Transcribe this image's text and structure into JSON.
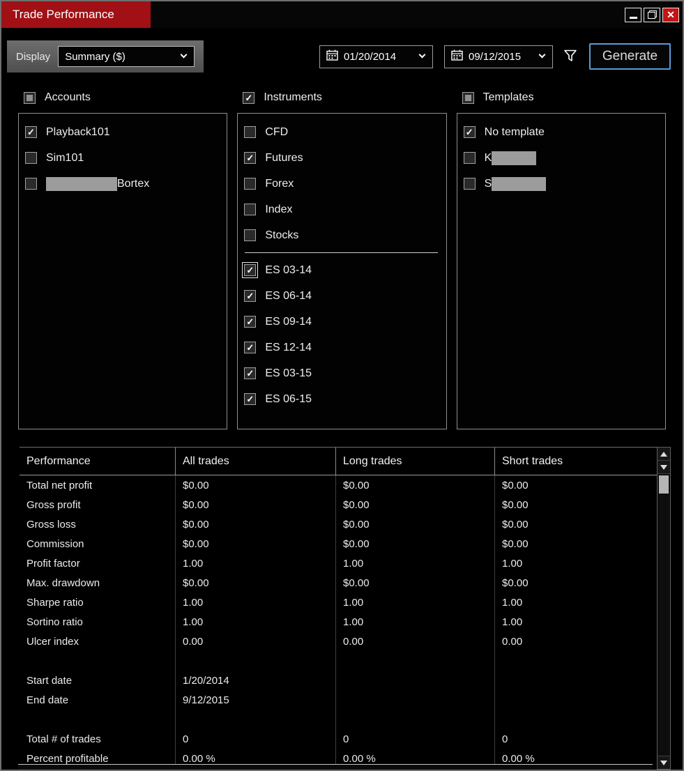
{
  "window": {
    "title": "Trade Performance"
  },
  "colors": {
    "title_red": "#a01015",
    "close_red": "#c41414",
    "generate_blue": "#5b9bd5",
    "redact_gray": "#9c9c9c"
  },
  "icons": {
    "check": "✓",
    "close": "✕"
  },
  "toolbar": {
    "display_label": "Display",
    "display_value": "Summary ($)",
    "date_from": "01/20/2014",
    "date_to": "09/12/2015",
    "generate_label": "Generate"
  },
  "sections": {
    "accounts": {
      "label": "Accounts",
      "state": "indeterminate",
      "items": [
        {
          "label": "Playback101",
          "checked": true
        },
        {
          "label": "Sim101",
          "checked": false
        },
        {
          "label": "Bortex",
          "checked": false,
          "redact": "prefix",
          "redact_width": 102
        }
      ]
    },
    "instruments": {
      "label": "Instruments",
      "state": "checked",
      "items": [
        {
          "label": "CFD",
          "checked": false
        },
        {
          "label": "Futures",
          "checked": true
        },
        {
          "label": "Forex",
          "checked": false
        },
        {
          "label": "Index",
          "checked": false
        },
        {
          "label": "Stocks",
          "checked": false,
          "divider_after": true
        },
        {
          "label": "ES 03-14",
          "checked": true,
          "focused": true
        },
        {
          "label": "ES 06-14",
          "checked": true
        },
        {
          "label": "ES 09-14",
          "checked": true
        },
        {
          "label": "ES 12-14",
          "checked": true
        },
        {
          "label": "ES 03-15",
          "checked": true
        },
        {
          "label": "ES 06-15",
          "checked": true
        }
      ]
    },
    "templates": {
      "label": "Templates",
      "state": "indeterminate",
      "items": [
        {
          "label": "No template",
          "checked": true
        },
        {
          "label": "K",
          "checked": false,
          "redact": "suffix",
          "redact_width": 64
        },
        {
          "label": "S",
          "checked": false,
          "redact": "suffix",
          "redact_width": 78
        }
      ]
    }
  },
  "table": {
    "headers": [
      "Performance",
      "All trades",
      "Long trades",
      "Short trades"
    ],
    "rows": [
      {
        "label": "Total net profit",
        "all": "$0.00",
        "long": "$0.00",
        "short": "$0.00"
      },
      {
        "label": "Gross profit",
        "all": "$0.00",
        "long": "$0.00",
        "short": "$0.00"
      },
      {
        "label": "Gross loss",
        "all": "$0.00",
        "long": "$0.00",
        "short": "$0.00"
      },
      {
        "label": "Commission",
        "all": "$0.00",
        "long": "$0.00",
        "short": "$0.00"
      },
      {
        "label": "Profit factor",
        "all": "1.00",
        "long": "1.00",
        "short": "1.00"
      },
      {
        "label": "Max. drawdown",
        "all": "$0.00",
        "long": "$0.00",
        "short": "$0.00"
      },
      {
        "label": "Sharpe ratio",
        "all": "1.00",
        "long": "1.00",
        "short": "1.00"
      },
      {
        "label": "Sortino ratio",
        "all": "1.00",
        "long": "1.00",
        "short": "1.00"
      },
      {
        "label": "Ulcer index",
        "all": "0.00",
        "long": "0.00",
        "short": "0.00"
      },
      {
        "label": "",
        "all": "",
        "long": "",
        "short": ""
      },
      {
        "label": "Start date",
        "all": "1/20/2014",
        "long": "",
        "short": ""
      },
      {
        "label": "End date",
        "all": "9/12/2015",
        "long": "",
        "short": ""
      },
      {
        "label": "",
        "all": "",
        "long": "",
        "short": ""
      },
      {
        "label": "Total # of trades",
        "all": "0",
        "long": "0",
        "short": "0"
      },
      {
        "label": "Percent profitable",
        "all": "0.00 %",
        "long": "0.00 %",
        "short": "0.00 %"
      }
    ]
  }
}
